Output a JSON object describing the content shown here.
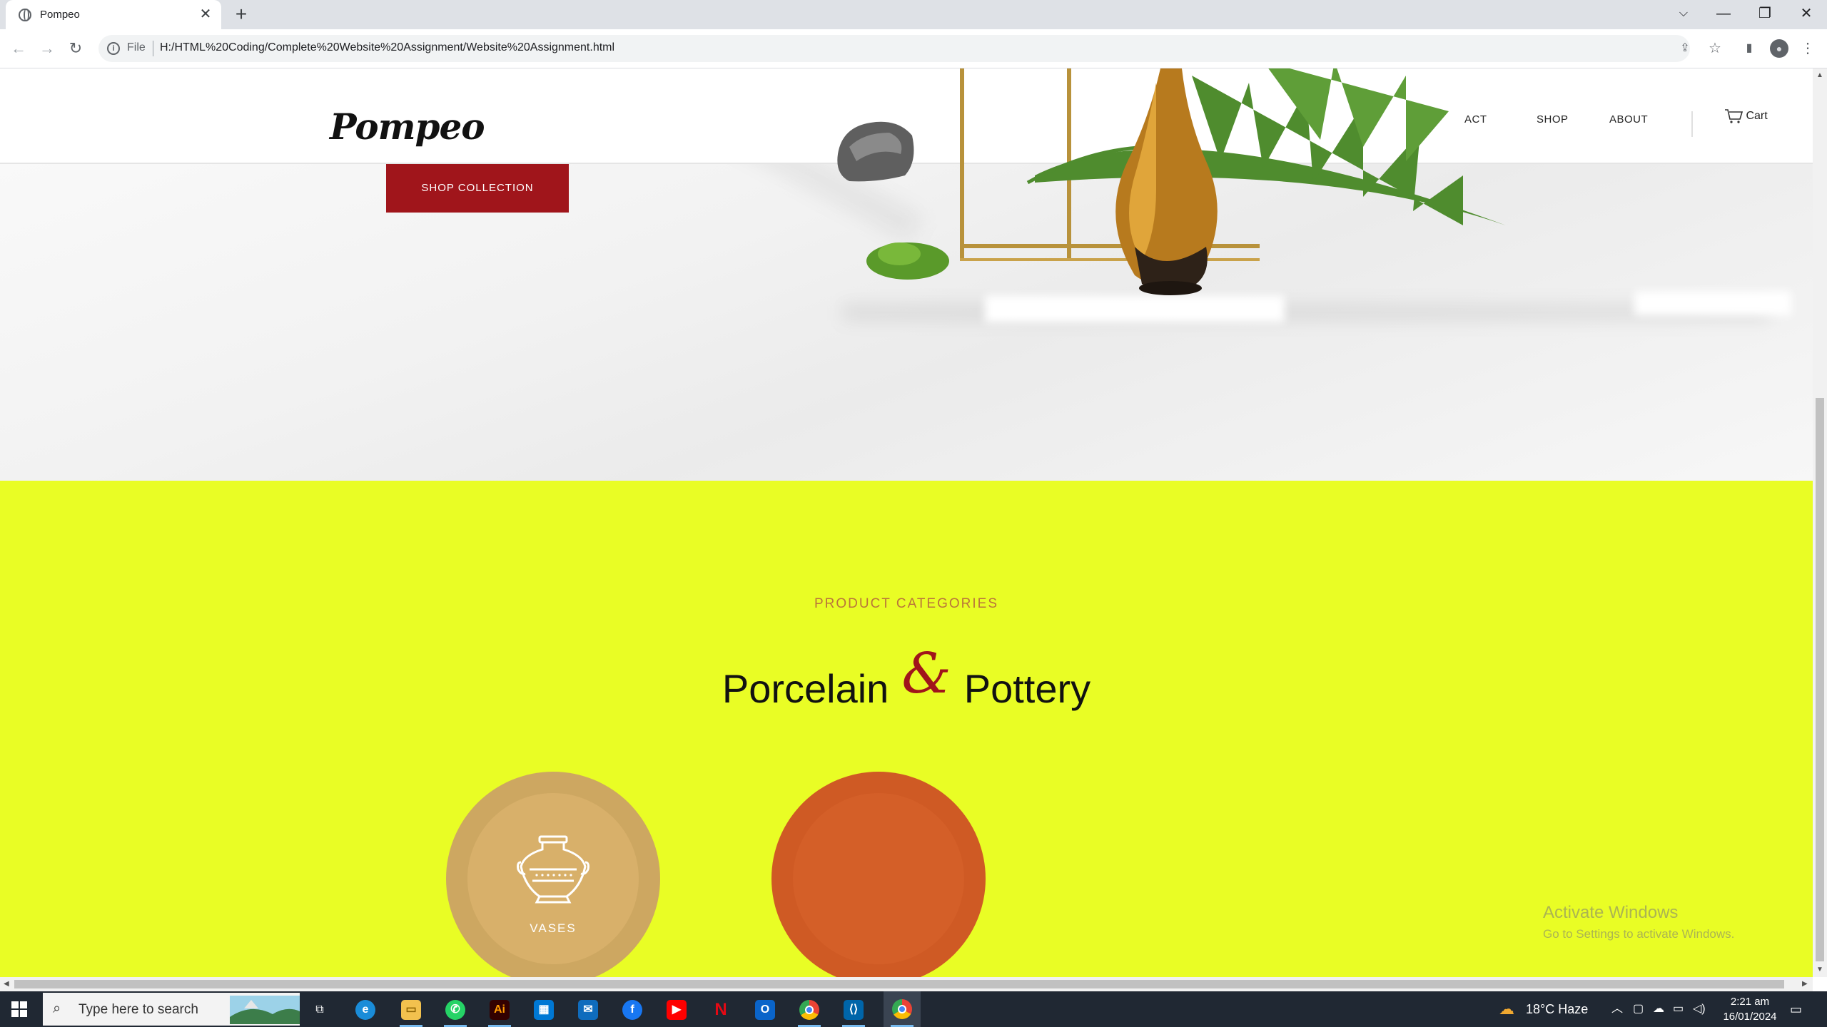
{
  "browser": {
    "tab_title": "Pompeo",
    "tab_close": "✕",
    "new_tab": "+",
    "window_controls": [
      "⌵",
      "—",
      "❐",
      "✕"
    ],
    "file_chip": "File",
    "url": "H:/HTML%20Coding/Complete%20Website%20Assignment/Website%20Assignment.html",
    "nav_icons": {
      "back": "←",
      "forward": "→",
      "reload": "↻"
    },
    "toolbar_icons": {
      "share": "⇪",
      "bookmark": "☆",
      "sidepanel": "▮",
      "profile": "●",
      "menu": "⋮"
    }
  },
  "site": {
    "logo": "Pompeo",
    "nav": {
      "contact_partial": "ACT",
      "shop": "SHOP",
      "about": "ABOUT",
      "cart": "Cart"
    },
    "hero": {
      "cta": "SHOP COLLECTION"
    },
    "categories": {
      "kicker": "PRODUCT CATEGORIES",
      "heading_left": "Porcelain",
      "heading_amp": "&",
      "heading_right": "Pottery",
      "items": [
        {
          "label": "VASES",
          "icon": "vase-icon"
        },
        {
          "label": "",
          "icon": ""
        }
      ]
    },
    "colors": {
      "accent": "#a0151b",
      "categories_bg": "#e9fd25",
      "kicker": "#b9743a",
      "vases_circle": "#cda761",
      "second_circle": "#cf5a24"
    }
  },
  "watermark": {
    "line1": "Activate Windows",
    "line2": "Go to Settings to activate Windows."
  },
  "taskbar": {
    "search_placeholder": "Type here to search",
    "apps": [
      "task-view",
      "edge",
      "file-explorer",
      "whatsapp",
      "illustrator",
      "store",
      "mail",
      "facebook",
      "youtube",
      "netflix",
      "outlook",
      "chrome",
      "vscode",
      "chrome-active"
    ],
    "weather": "18°C  Haze",
    "time": "2:21 am",
    "date": "16/01/2024"
  }
}
